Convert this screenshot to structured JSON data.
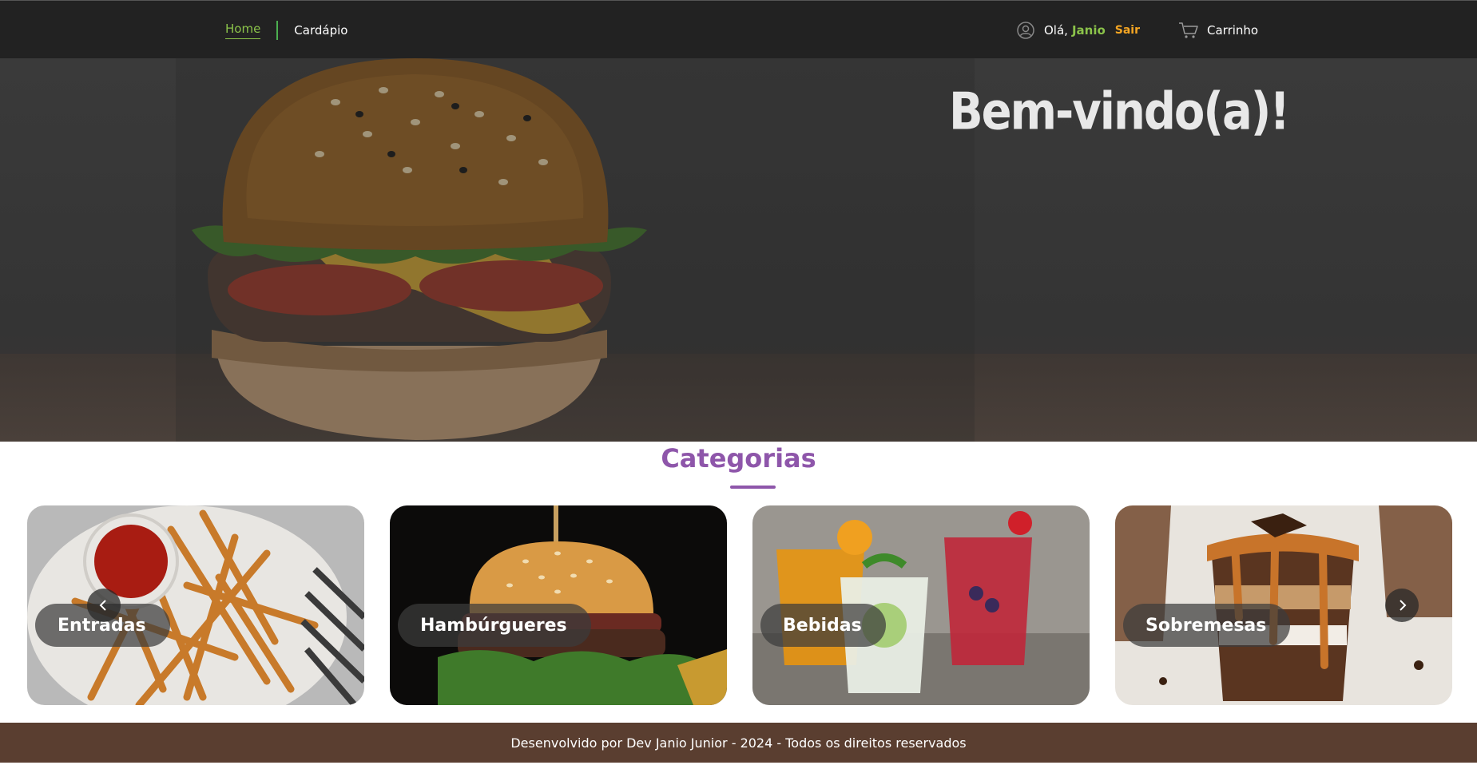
{
  "nav": {
    "home_label": "Home",
    "menu_label": "Cardápio",
    "greeting": "Olá,",
    "username": "Janio",
    "logout_label": "Sair",
    "cart_label": "Carrinho"
  },
  "hero": {
    "title": "Bem-vindo(a)!"
  },
  "categories": {
    "title": "Categorias",
    "items": [
      {
        "label": "Entradas"
      },
      {
        "label": "Hambúrgueres"
      },
      {
        "label": "Bebidas"
      },
      {
        "label": "Sobremesas"
      }
    ],
    "prev_icon": "chevron-left-icon",
    "next_icon": "chevron-right-icon"
  },
  "footer": {
    "text": "Desenvolvido por Dev Janio Junior - 2024 - Todos os direitos reservados"
  },
  "colors": {
    "nav_bg": "#222222",
    "active_link": "#8bc34a",
    "username": "#8bc34a",
    "logout": "#f5a623",
    "category_title": "#8e56aa",
    "footer_bg": "#5a3e30"
  }
}
